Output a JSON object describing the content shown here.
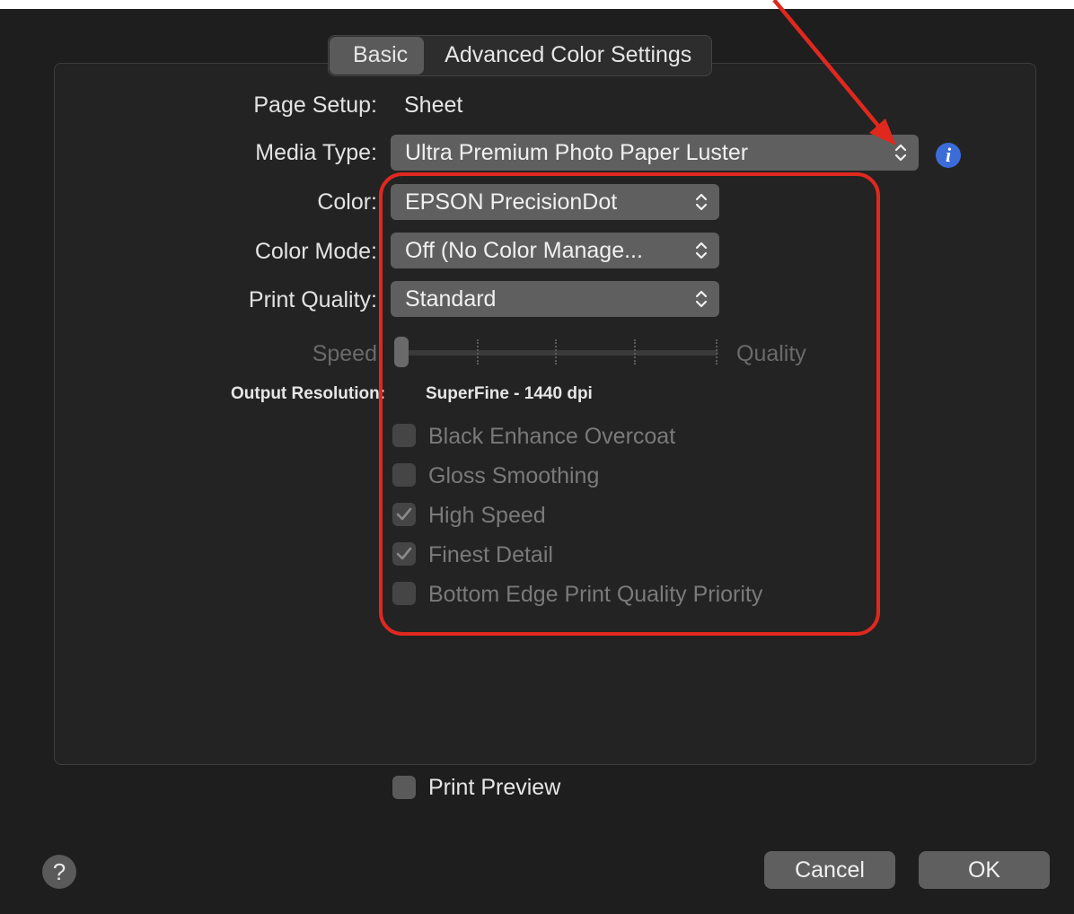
{
  "tabs": [
    {
      "label": "Basic",
      "active": true
    },
    {
      "label": "Advanced Color Settings",
      "active": false
    }
  ],
  "page_setup": {
    "label": "Page Setup:",
    "value": "Sheet"
  },
  "media_type": {
    "label": "Media Type:",
    "value": "Ultra Premium Photo Paper Luster"
  },
  "color": {
    "label": "Color:",
    "value": "EPSON PrecisionDot"
  },
  "color_mode": {
    "label": "Color Mode:",
    "value": "Off (No Color Manage..."
  },
  "print_quality": {
    "label": "Print Quality:",
    "value": "Standard"
  },
  "slider": {
    "min_label": "Speed",
    "max_label": "Quality",
    "positions": 5,
    "value_index": 0,
    "enabled": false
  },
  "output_resolution": {
    "label": "Output Resolution:",
    "value": "SuperFine - 1440 dpi"
  },
  "options": [
    {
      "label": "Black Enhance Overcoat",
      "checked": false,
      "enabled": false
    },
    {
      "label": "Gloss Smoothing",
      "checked": false,
      "enabled": false
    },
    {
      "label": "High Speed",
      "checked": true,
      "enabled": false
    },
    {
      "label": "Finest Detail",
      "checked": true,
      "enabled": false
    },
    {
      "label": "Bottom Edge Print Quality Priority",
      "checked": false,
      "enabled": false
    }
  ],
  "print_preview": {
    "label": "Print Preview",
    "checked": false
  },
  "help_glyph": "?",
  "info_glyph": "i",
  "buttons": {
    "cancel": "Cancel",
    "ok": "OK"
  },
  "colors": {
    "annotation": "#e0281f",
    "info": "#3b6cd8",
    "dialog_bg": "#1e1e1e"
  }
}
